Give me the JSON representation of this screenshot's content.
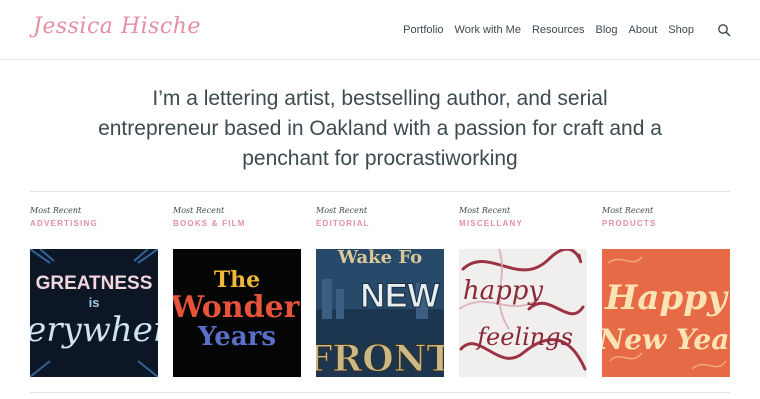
{
  "header": {
    "logo_text": "Jessica Hische",
    "nav": [
      "Portfolio",
      "Work with Me",
      "Resources",
      "Blog",
      "About",
      "Shop"
    ],
    "search_icon": "search-icon"
  },
  "intro": {
    "line1": "I’m a lettering artist, bestselling author, and serial",
    "line2": "entrepreneur based in Oakland with a passion for craft and a",
    "line3": "penchant for procrastiworking"
  },
  "columns": [
    {
      "kicker": "Most Recent",
      "category": "ADVERTISING",
      "thumb": {
        "line1": "GREATNESS",
        "line2": "is",
        "line3": "everywhere"
      }
    },
    {
      "kicker": "Most Recent",
      "category": "BOOKS & FILM",
      "thumb": {
        "line1": "The",
        "line2": "Wonder",
        "line3": "Years"
      }
    },
    {
      "kicker": "Most Recent",
      "category": "EDITORIAL",
      "thumb": {
        "line1": "Wake Fo",
        "line2": "NEW",
        "line3": "FRONT"
      }
    },
    {
      "kicker": "Most Recent",
      "category": "MISCELLANY",
      "thumb": {
        "line1": "happy",
        "line2": "feelings"
      }
    },
    {
      "kicker": "Most Recent",
      "category": "PRODUCTS",
      "thumb": {
        "line1": "Happy",
        "line2": "New Yea"
      }
    }
  ],
  "colors": {
    "accent": "#e48fa3",
    "text": "#3d4a4f"
  }
}
